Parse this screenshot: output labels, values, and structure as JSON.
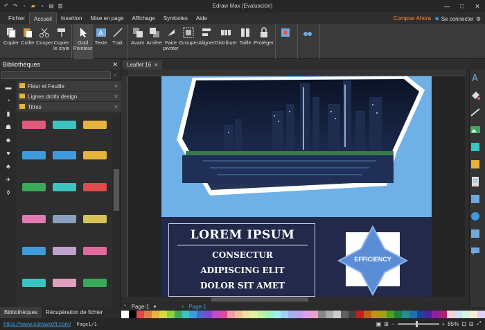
{
  "app": {
    "title": "Edraw Max (Evaluación)",
    "buy_label": "Comprar Ahora",
    "signin_label": "Se connecter"
  },
  "menu": {
    "tabs": [
      {
        "label": "Fichier"
      },
      {
        "label": "Accueil"
      },
      {
        "label": "Insertion"
      },
      {
        "label": "Mise en page"
      },
      {
        "label": "Affichage"
      },
      {
        "label": "Symboles"
      },
      {
        "label": "Aide"
      }
    ],
    "active_tab": "Accueil"
  },
  "ribbon": {
    "clipboard": [
      {
        "label": "Copier"
      },
      {
        "label": "Coller"
      },
      {
        "label": "Couper"
      },
      {
        "label": "Copier\nle style"
      }
    ],
    "tools": [
      {
        "label": "Outil\nPointeur"
      },
      {
        "label": "Texte"
      },
      {
        "label": "Trait"
      }
    ],
    "arrange": [
      {
        "label": "Avant"
      },
      {
        "label": "Arrière"
      },
      {
        "label": "Faire\npivoter"
      },
      {
        "label": "Grouper"
      },
      {
        "label": "Aligner"
      },
      {
        "label": "Distribuer"
      },
      {
        "label": "Taille"
      },
      {
        "label": "Protéger"
      }
    ]
  },
  "libraries": {
    "title": "Bibliothèques",
    "items": [
      {
        "label": "Fleur et Feuille"
      },
      {
        "label": "Lignes droits design"
      },
      {
        "label": "Titres"
      }
    ],
    "bottom_tabs": [
      {
        "label": "Bibliothèques"
      },
      {
        "label": "Récupération de fichier"
      }
    ]
  },
  "document": {
    "tab_label": "Leaflet 16",
    "page_label": "Page-1",
    "current_page": "Page-1"
  },
  "flyer": {
    "title": "LOREM IPSUM",
    "line1": "CONSECTUR",
    "line2": "ADIPISCING ELIT",
    "line3": "DOLOR SIT AMET",
    "badge": "EFFICIENCY"
  },
  "status": {
    "website": "https://www.edrawsoft.com/",
    "page_info": "Page1/1",
    "zoom": "85%"
  },
  "colors": {
    "accent": "#3f9bdc",
    "buy": "#ff8a3d",
    "flyer_sky": "#6fb0e6",
    "flyer_navy": "#23294a",
    "badge_blue": "#5b8dd6"
  }
}
